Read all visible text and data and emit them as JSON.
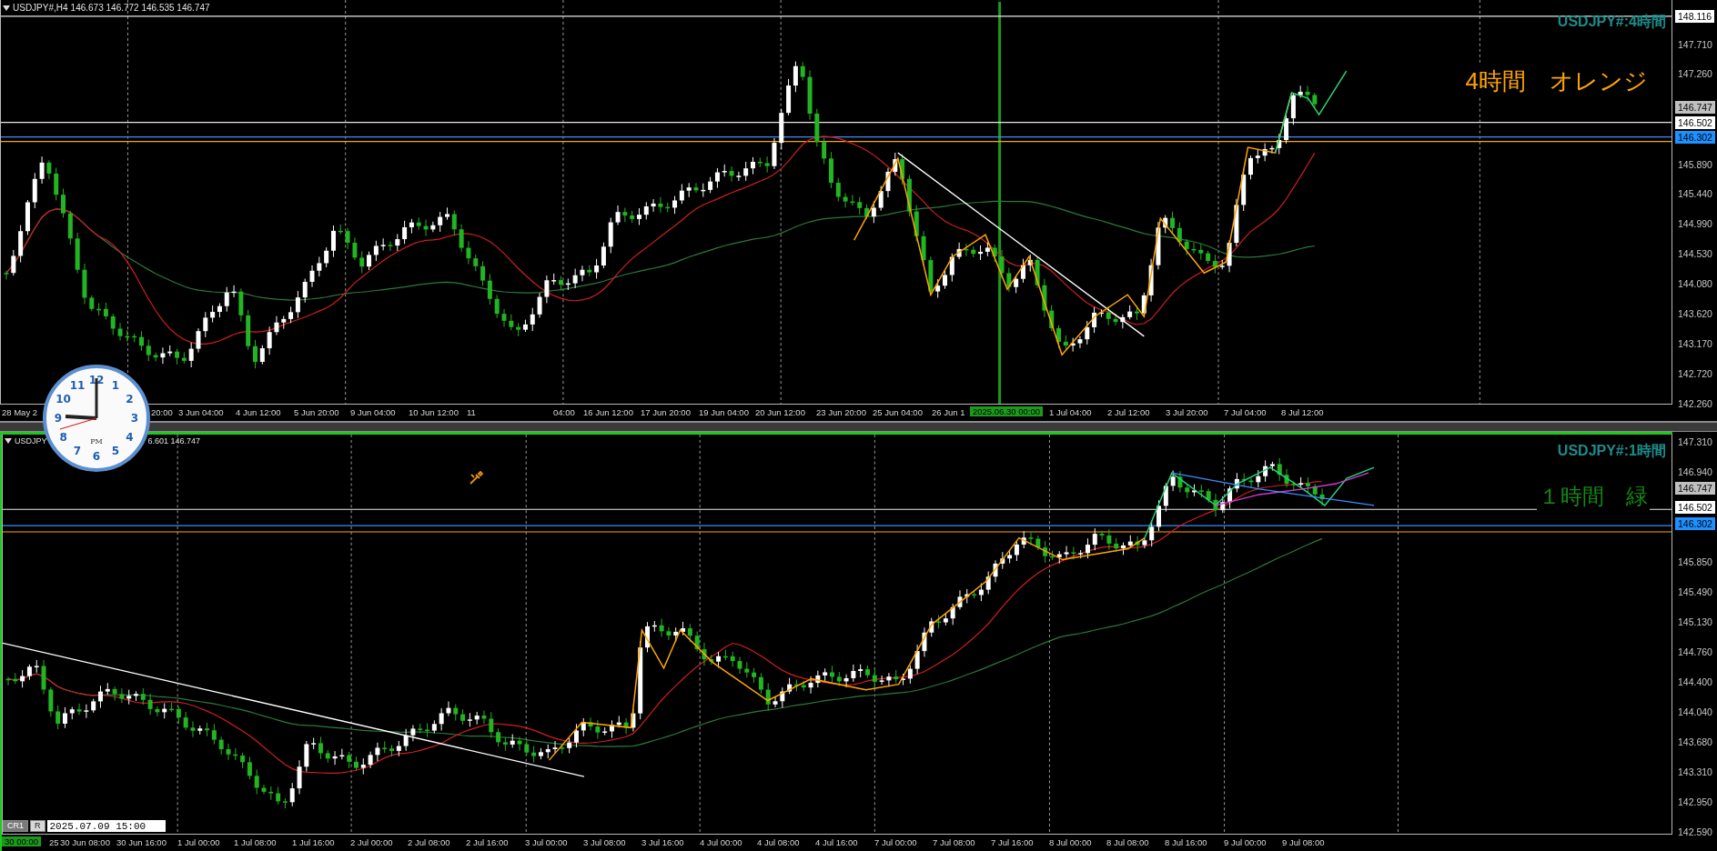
{
  "panels": [
    {
      "active": false,
      "header": {
        "symbol": "USDJPY#,H4",
        "quotes": "146.673 146.772 146.535 146.747"
      },
      "title": "USDJPY#:4時間",
      "note": {
        "text": "4時間　オレンジ",
        "color": "#ffa500"
      },
      "price_labels": [
        {
          "text": "148.116",
          "kind": "level"
        },
        {
          "text": "147.710",
          "kind": "tick"
        },
        {
          "text": "147.260",
          "kind": "tick"
        },
        {
          "text": "146.747",
          "kind": "bid"
        },
        {
          "text": "146.502",
          "kind": "level"
        },
        {
          "text": "146.302",
          "kind": "line"
        },
        {
          "text": "145.890",
          "kind": "tick"
        },
        {
          "text": "145.440",
          "kind": "tick"
        },
        {
          "text": "144.990",
          "kind": "tick"
        },
        {
          "text": "144.530",
          "kind": "tick"
        },
        {
          "text": "144.080",
          "kind": "tick"
        },
        {
          "text": "143.620",
          "kind": "tick"
        },
        {
          "text": "143.170",
          "kind": "tick"
        },
        {
          "text": "142.720",
          "kind": "tick"
        },
        {
          "text": "142.260",
          "kind": "tick"
        }
      ],
      "time_labels": [
        {
          "text": "28 May 2",
          "kind": "tick"
        },
        {
          "text": "20:00",
          "kind": "tick"
        },
        {
          "text": "3 Jun 04:00",
          "kind": "tick"
        },
        {
          "text": "4 Jun 12:00",
          "kind": "tick"
        },
        {
          "text": "5 Jun 20:00",
          "kind": "tick"
        },
        {
          "text": "9 Jun 04:00",
          "kind": "tick"
        },
        {
          "text": "10 Jun 12:00",
          "kind": "tick"
        },
        {
          "text": "11",
          "kind": "tick"
        },
        {
          "text": "04:00",
          "kind": "tick"
        },
        {
          "text": "16 Jun 12:00",
          "kind": "tick"
        },
        {
          "text": "17 Jun 20:00",
          "kind": "tick"
        },
        {
          "text": "19 Jun 04:00",
          "kind": "tick"
        },
        {
          "text": "20 Jun 12:00",
          "kind": "tick"
        },
        {
          "text": "23 Jun 20:00",
          "kind": "tick"
        },
        {
          "text": "25 Jun 04:00",
          "kind": "tick"
        },
        {
          "text": "26 Jun 1",
          "kind": "tick"
        },
        {
          "text": "2025.06.30 00:00",
          "kind": "cursor"
        },
        {
          "text": "1 Jul 04:00",
          "kind": "tick"
        },
        {
          "text": "2 Jul 12:00",
          "kind": "tick"
        },
        {
          "text": "3 Jul 20:00",
          "kind": "tick"
        },
        {
          "text": "7 Jul 04:00",
          "kind": "tick"
        },
        {
          "text": "8 Jul 12:00",
          "kind": "tick"
        }
      ]
    },
    {
      "active": true,
      "header": {
        "symbol": "USDJPY",
        "quotes": "6.601 146.747"
      },
      "title": "USDJPY#:1時間",
      "note": {
        "text": "１時間　緑",
        "color": "#138a13"
      },
      "price_labels": [
        {
          "text": "147.310",
          "kind": "tick"
        },
        {
          "text": "146.940",
          "kind": "tick"
        },
        {
          "text": "146.747",
          "kind": "bid"
        },
        {
          "text": "146.502",
          "kind": "level"
        },
        {
          "text": "146.302",
          "kind": "line"
        },
        {
          "text": "145.850",
          "kind": "tick"
        },
        {
          "text": "145.490",
          "kind": "tick"
        },
        {
          "text": "145.130",
          "kind": "tick"
        },
        {
          "text": "144.760",
          "kind": "tick"
        },
        {
          "text": "144.400",
          "kind": "tick"
        },
        {
          "text": "144.040",
          "kind": "tick"
        },
        {
          "text": "143.680",
          "kind": "tick"
        },
        {
          "text": "143.310",
          "kind": "tick"
        },
        {
          "text": "142.950",
          "kind": "tick"
        },
        {
          "text": "142.590",
          "kind": "tick"
        }
      ],
      "time_labels": [
        {
          "text": "30 00:00",
          "kind": "cursor"
        },
        {
          "text": "25",
          "kind": "tick"
        },
        {
          "text": "30 Jun 08:00",
          "kind": "tick"
        },
        {
          "text": "30 Jun 16:00",
          "kind": "tick"
        },
        {
          "text": "1 Jul 00:00",
          "kind": "tick"
        },
        {
          "text": "1 Jul 08:00",
          "kind": "tick"
        },
        {
          "text": "1 Jul 16:00",
          "kind": "tick"
        },
        {
          "text": "2 Jul 00:00",
          "kind": "tick"
        },
        {
          "text": "2 Jul 08:00",
          "kind": "tick"
        },
        {
          "text": "2 Jul 16:00",
          "kind": "tick"
        },
        {
          "text": "3 Jul 00:00",
          "kind": "tick"
        },
        {
          "text": "3 Jul 08:00",
          "kind": "tick"
        },
        {
          "text": "3 Jul 16:00",
          "kind": "tick"
        },
        {
          "text": "4 Jul 00:00",
          "kind": "tick"
        },
        {
          "text": "4 Jul 08:00",
          "kind": "tick"
        },
        {
          "text": "4 Jul 16:00",
          "kind": "tick"
        },
        {
          "text": "7 Jul 00:00",
          "kind": "tick"
        },
        {
          "text": "7 Jul 08:00",
          "kind": "tick"
        },
        {
          "text": "7 Jul 16:00",
          "kind": "tick"
        },
        {
          "text": "8 Jul 00:00",
          "kind": "tick"
        },
        {
          "text": "8 Jul 08:00",
          "kind": "tick"
        },
        {
          "text": "8 Jul 16:00",
          "kind": "tick"
        },
        {
          "text": "9 Jul 00:00",
          "kind": "tick"
        },
        {
          "text": "9 Jul 08:00",
          "kind": "tick"
        }
      ]
    }
  ],
  "clock": {
    "numerals": [
      "12",
      "11",
      "1",
      "10",
      "2",
      "9",
      "3",
      "8",
      "4",
      "7",
      "5",
      "6"
    ],
    "period": "PM"
  },
  "toolbar": {
    "buttons": [
      "CR1",
      "R"
    ],
    "date": "2025.07.09 15:00"
  }
}
